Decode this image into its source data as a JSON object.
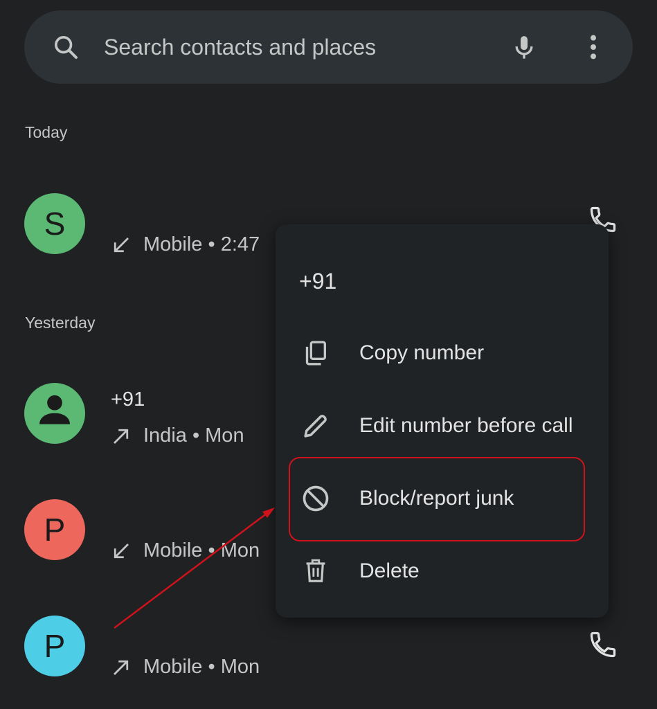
{
  "search": {
    "placeholder": "Search contacts and places",
    "search_icon": "search-icon",
    "mic_icon": "mic-icon",
    "more_icon": "more-vert-icon"
  },
  "sections": {
    "today": "Today",
    "yesterday": "Yesterday"
  },
  "calls": [
    {
      "avatar": "S",
      "avatar_color": "#5bb974",
      "name": "",
      "direction": "incoming",
      "meta": "Mobile • 2:47"
    },
    {
      "avatar": "",
      "avatar_color": "#5bb974",
      "name": "+91",
      "direction": "outgoing",
      "meta": "India • Mon"
    },
    {
      "avatar": "P",
      "avatar_color": "#ee675c",
      "name": "",
      "direction": "incoming",
      "meta": "Mobile • Mon"
    },
    {
      "avatar": "P",
      "avatar_color": "#4ecde6",
      "name": "",
      "direction": "outgoing",
      "meta": "Mobile • Mon"
    }
  ],
  "menu": {
    "title": "+91",
    "items": [
      {
        "label": "Copy number",
        "icon": "copy-icon"
      },
      {
        "label": "Edit number before call",
        "icon": "pencil-icon"
      },
      {
        "label": "Block/report junk",
        "icon": "block-icon"
      },
      {
        "label": "Delete",
        "icon": "trash-icon"
      }
    ]
  },
  "annotation": {
    "color": "#d0121b",
    "highlighted_item": "Block/report junk"
  }
}
